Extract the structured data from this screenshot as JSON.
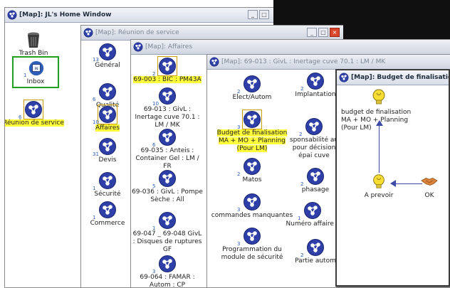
{
  "win_home": {
    "title": "[Map]:  JL's Home Window",
    "trash": "Trash Bin",
    "inbox": "Inbox",
    "inbox_count": "1",
    "reunion": "Réunion de service",
    "reunion_count": "6"
  },
  "win_reunion": {
    "title": "[Map]: Réunion de service",
    "items": [
      {
        "label": "Général",
        "count": "13"
      },
      {
        "label": "Qualité",
        "count": "6"
      },
      {
        "label": "Affaires",
        "count": "10"
      },
      {
        "label": "Devis",
        "count": "31"
      },
      {
        "label": "Sécurité",
        "count": "1"
      },
      {
        "label": "Commerce",
        "count": "1"
      }
    ]
  },
  "win_affaires": {
    "title": "[Map]: Affaires",
    "items": [
      {
        "label": "69-003 : BIC : PM43A",
        "count": "2"
      },
      {
        "label": "69-013 : GivL : Inertage cuve 70.1 : LM / MK",
        "count": "10"
      },
      {
        "label": "69-035 : Anteis : Container Gel : LM / FR",
        "count": "6"
      },
      {
        "label": "69-036 : GivL : Pompe Sèche : All",
        "count": "5"
      },
      {
        "label": "69-047 _ 69-048 GivL : Disques de ruptures GF",
        "count": "1"
      },
      {
        "label": "69-064 : FAMAR : Autom : CP",
        "count": "3"
      }
    ]
  },
  "win_inertage": {
    "title": "[Map]: 69-013 : GivL : Inertage cuve 70.1 : LM / MK",
    "left": [
      {
        "label": "Elect/Autom",
        "count": "2"
      },
      {
        "label": "Budget de finalisation MA + MO + Planning (Pour LM)",
        "count": "3"
      },
      {
        "label": "Matos",
        "count": "2"
      },
      {
        "label": "commandes manquantes",
        "count": "3"
      },
      {
        "label": "Programmation du module de sécurité",
        "count": "3"
      }
    ],
    "right": [
      {
        "label": "Implantation",
        "count": "2"
      },
      {
        "label": "sponsabilité au pour décision épai cuve",
        "count": "2"
      },
      {
        "label": "phasage",
        "count": "2"
      },
      {
        "label": "Numéro affaire s",
        "count": "1"
      },
      {
        "label": "Partie autom",
        "count": "2"
      }
    ]
  },
  "win_budget": {
    "title": "[Map]: Budget de finalisation MA",
    "idea1": "budget de finalisation MA + MO + Planning (Pour LM)",
    "idea2": "A prevoir",
    "ok": "OK"
  },
  "colors": {
    "node_blue": "#2e3fa8",
    "highlight": "#ffff3a",
    "inbox_green": "#22a022"
  }
}
